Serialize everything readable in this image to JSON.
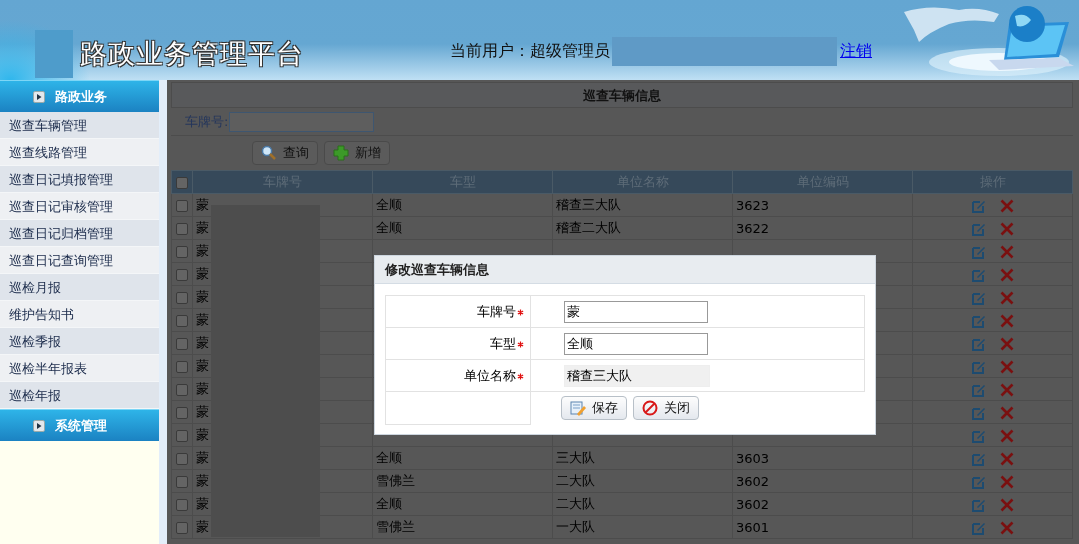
{
  "header": {
    "title": "路政业务管理平台",
    "user_label": "当前用户：超级管理员",
    "logout": "注销"
  },
  "sidebar": {
    "sections": [
      {
        "title": "路政业务",
        "items": [
          {
            "label": "巡查车辆管理"
          },
          {
            "label": "巡查线路管理"
          },
          {
            "label": "巡查日记填报管理"
          },
          {
            "label": "巡查日记审核管理"
          },
          {
            "label": "巡查日记归档管理"
          },
          {
            "label": "巡查日记查询管理"
          },
          {
            "label": "巡检月报"
          },
          {
            "label": "维护告知书"
          },
          {
            "label": "巡检季报"
          },
          {
            "label": "巡检半年报表"
          },
          {
            "label": "巡检年报"
          }
        ]
      },
      {
        "title": "系统管理"
      }
    ]
  },
  "panel": {
    "title": "巡查车辆信息",
    "search": {
      "label": "车牌号:"
    },
    "buttons": [
      {
        "label": "查询",
        "kind": "search"
      },
      {
        "label": "新增",
        "kind": "add"
      }
    ],
    "table": {
      "select_all": {
        "checked": false
      },
      "columns": [
        "车牌号",
        "车型",
        "单位名称",
        "单位编码",
        "操作"
      ],
      "rows": [
        {
          "checked": false,
          "plate": "蒙",
          "type": "全顺",
          "unit": "稽查三大队",
          "code": "3623"
        },
        {
          "checked": false,
          "plate": "蒙",
          "type": "全顺",
          "unit": "稽查二大队",
          "code": "3622"
        },
        {
          "checked": false,
          "plate": "蒙"
        },
        {
          "checked": false,
          "plate": "蒙"
        },
        {
          "checked": false,
          "plate": "蒙"
        },
        {
          "checked": false,
          "plate": "蒙"
        },
        {
          "checked": false,
          "plate": "蒙"
        },
        {
          "checked": false,
          "plate": "蒙"
        },
        {
          "checked": false,
          "plate": "蒙"
        },
        {
          "checked": false,
          "plate": "蒙"
        },
        {
          "checked": false,
          "plate": "蒙"
        },
        {
          "checked": false,
          "plate": "蒙",
          "type": "全顺",
          "unit": "三大队",
          "code": "3603"
        },
        {
          "checked": false,
          "plate": "蒙",
          "type": "雪佛兰",
          "unit": "二大队",
          "code": "3602"
        },
        {
          "checked": false,
          "plate": "蒙",
          "type": "全顺",
          "unit": "二大队",
          "code": "3602"
        },
        {
          "checked": false,
          "plate": "蒙",
          "type": "雪佛兰",
          "unit": "一大队",
          "code": "3601"
        }
      ]
    }
  },
  "dialog": {
    "title": "修改巡查车辆信息",
    "fields": [
      {
        "label": "车牌号",
        "required": true,
        "kind": "input",
        "value": "蒙"
      },
      {
        "label": "车型",
        "required": true,
        "kind": "input",
        "value": "全顺"
      },
      {
        "label": "单位名称",
        "required": true,
        "kind": "readonly",
        "value": "稽查三大队"
      }
    ],
    "buttons": [
      {
        "label": "保存",
        "kind": "save"
      },
      {
        "label": "关闭",
        "kind": "close"
      }
    ]
  }
}
